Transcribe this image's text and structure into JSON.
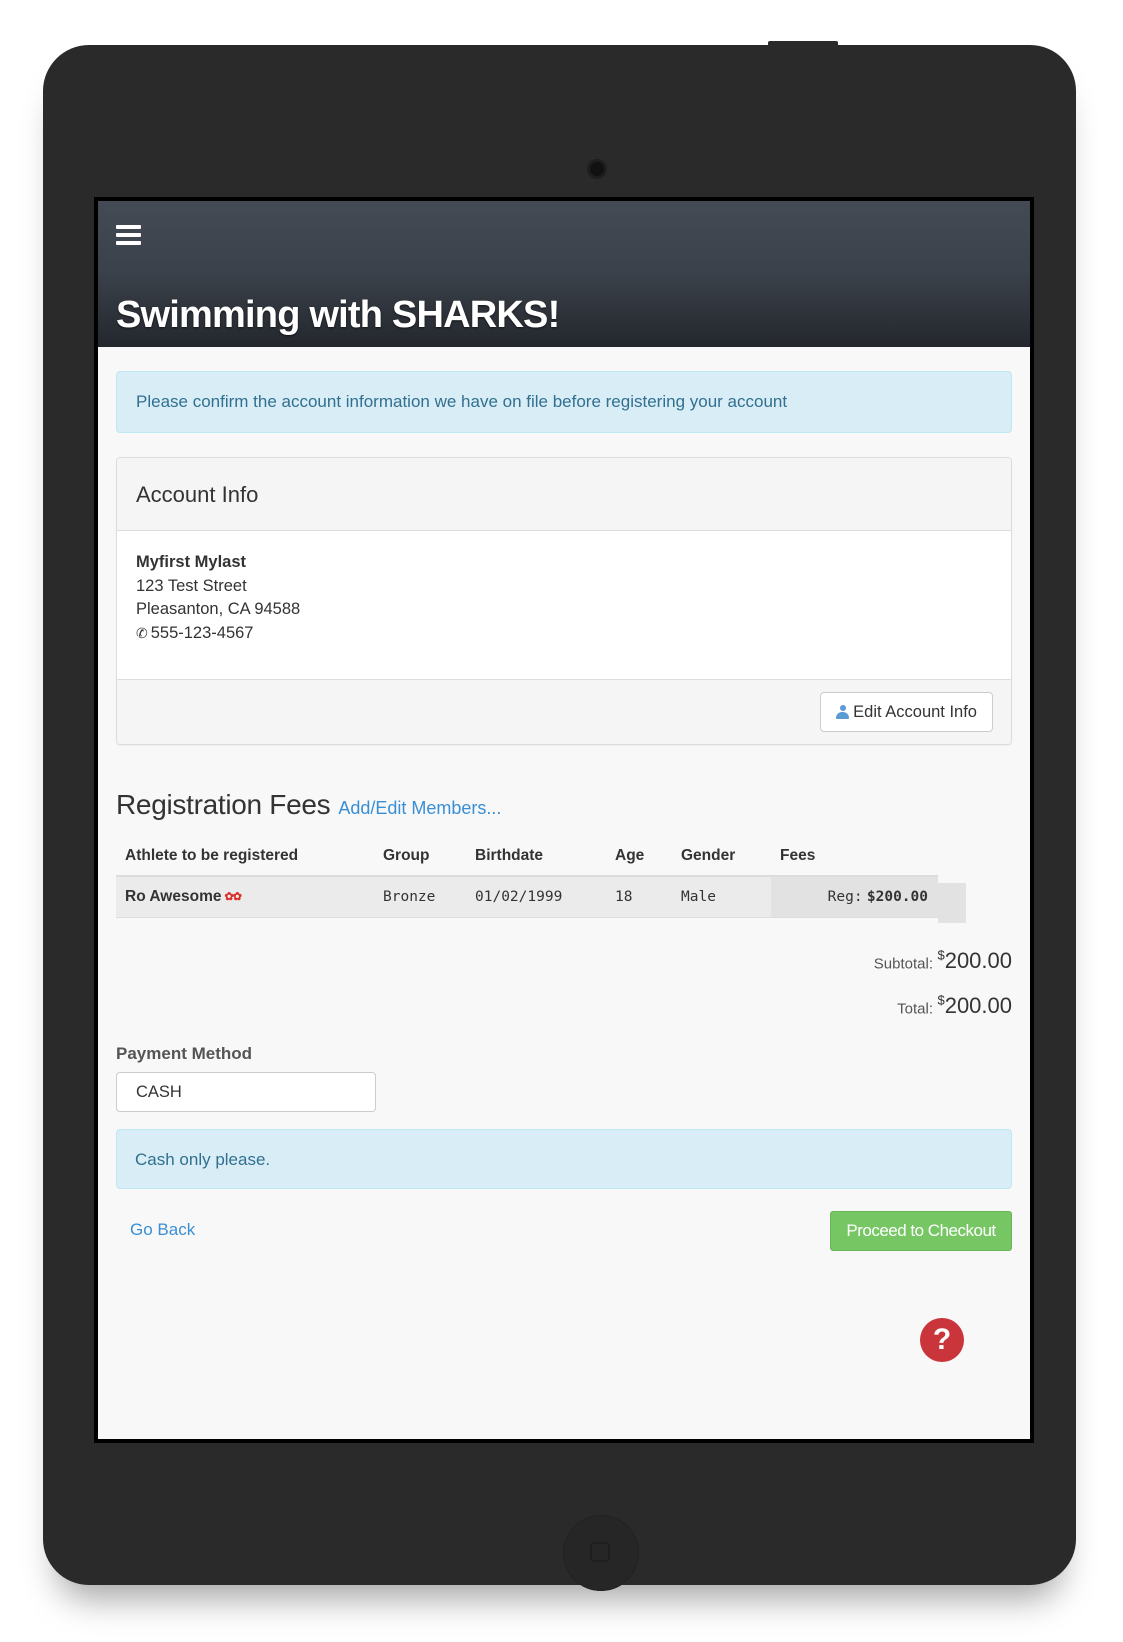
{
  "app": {
    "title": "Swimming with SHARKS!"
  },
  "notices": {
    "confirm": "Please confirm the account information we have on file before registering your account",
    "payment_note": "Cash only please."
  },
  "account": {
    "heading": "Account Info",
    "name": "Myfirst Mylast",
    "street": "123 Test Street",
    "city_line": "Pleasanton, CA 94588",
    "phone": "555-123-4567",
    "edit_button": "Edit Account Info"
  },
  "registration": {
    "title": "Registration Fees",
    "edit_members_link": "Add/Edit Members...",
    "columns": [
      "Athlete to be registered",
      "Group",
      "Birthdate",
      "Age",
      "Gender",
      "Fees"
    ],
    "rows": [
      {
        "athlete": "Ro Awesome",
        "group": "Bronze",
        "birthdate": "01/02/1999",
        "age": "18",
        "gender": "Male",
        "fee_label": "Reg:",
        "fee_amount": "$200.00"
      }
    ]
  },
  "totals": {
    "subtotal_label": "Subtotal:",
    "subtotal_currency": "$",
    "subtotal_value": "200.00",
    "total_label": "Total:",
    "total_currency": "$",
    "total_value": "200.00"
  },
  "payment": {
    "label": "Payment Method",
    "value": "CASH"
  },
  "actions": {
    "back": "Go Back",
    "checkout": "Proceed to Checkout"
  },
  "icons": {
    "menu": "hamburger-menu-icon",
    "phone": "phone-icon",
    "user": "user-icon",
    "help": "help-icon"
  },
  "colors": {
    "navbar": "#3b414a",
    "info_background": "#d9edf7",
    "info_text": "#31708f",
    "link": "#3a8fd4",
    "success": "#76c664",
    "help": "#c9353b"
  }
}
